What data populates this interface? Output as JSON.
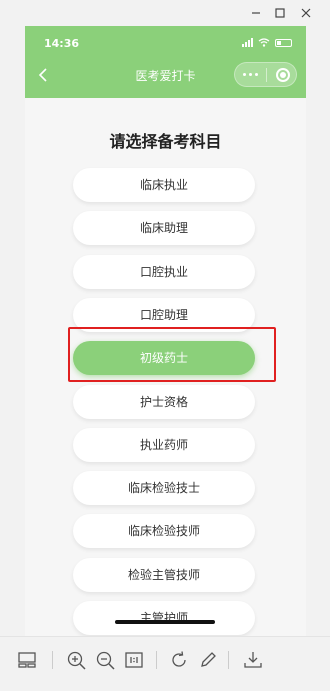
{
  "status_bar": {
    "time": "14:36"
  },
  "nav": {
    "title": "医考爱打卡"
  },
  "page": {
    "heading": "请选择备考科目"
  },
  "subjects": [
    {
      "label": "临床执业",
      "selected": false
    },
    {
      "label": "临床助理",
      "selected": false
    },
    {
      "label": "口腔执业",
      "selected": false
    },
    {
      "label": "口腔助理",
      "selected": false
    },
    {
      "label": "初级药士",
      "selected": true
    },
    {
      "label": "护士资格",
      "selected": false
    },
    {
      "label": "执业药师",
      "selected": false
    },
    {
      "label": "临床检验技士",
      "selected": false
    },
    {
      "label": "临床检验技师",
      "selected": false
    },
    {
      "label": "检验主管技师",
      "selected": false
    },
    {
      "label": "主管护师",
      "selected": false
    }
  ],
  "colors": {
    "accent": "#8bd07a",
    "highlight": "#e02020"
  },
  "toolbar_icons": [
    "layout-icon",
    "zoom-in-icon",
    "zoom-out-icon",
    "actual-size-icon",
    "rotate-icon",
    "edit-icon",
    "download-icon"
  ]
}
